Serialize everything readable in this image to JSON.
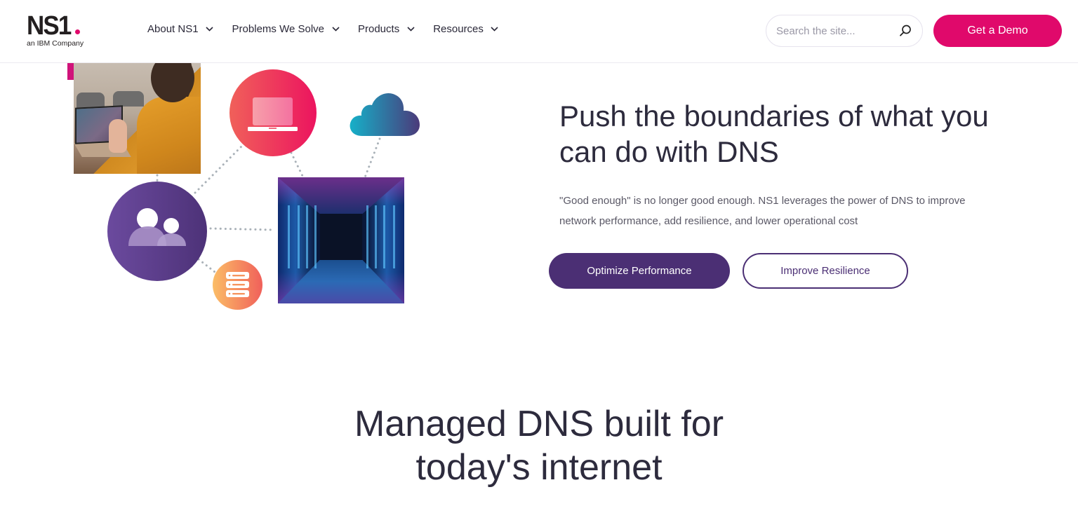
{
  "colors": {
    "brand_pink": "#e0096b",
    "brand_purple": "#4b2f74",
    "text_dark": "#2d2b3d",
    "text_muted": "#5a5866"
  },
  "header": {
    "logo": {
      "mark": "NS1",
      "subtitle": "an IBM Company"
    },
    "nav": [
      {
        "label": "About NS1",
        "icon": "chevron-down-icon"
      },
      {
        "label": "Problems We Solve",
        "icon": "chevron-down-icon"
      },
      {
        "label": "Products",
        "icon": "chevron-down-icon"
      },
      {
        "label": "Resources",
        "icon": "chevron-down-icon"
      }
    ],
    "search": {
      "value": "",
      "placeholder": "Search the site...",
      "icon": "search-icon"
    },
    "cta_label": "Get a Demo"
  },
  "hero": {
    "title": "Push the boundaries of what you can do with DNS",
    "description": "\"Good enough\" is no longer good enough. NS1 leverages the power of DNS to improve network performance, add resilience, and lower operational cost",
    "primary_button": "Optimize Performance",
    "secondary_button": "Improve Resilience",
    "illustration": {
      "items": [
        "video-call-photo",
        "laptop-icon",
        "cloud-icon",
        "people-icon",
        "data-center-photo",
        "server-stack-icon"
      ]
    }
  },
  "section": {
    "title": "Managed DNS built for today's internet"
  }
}
